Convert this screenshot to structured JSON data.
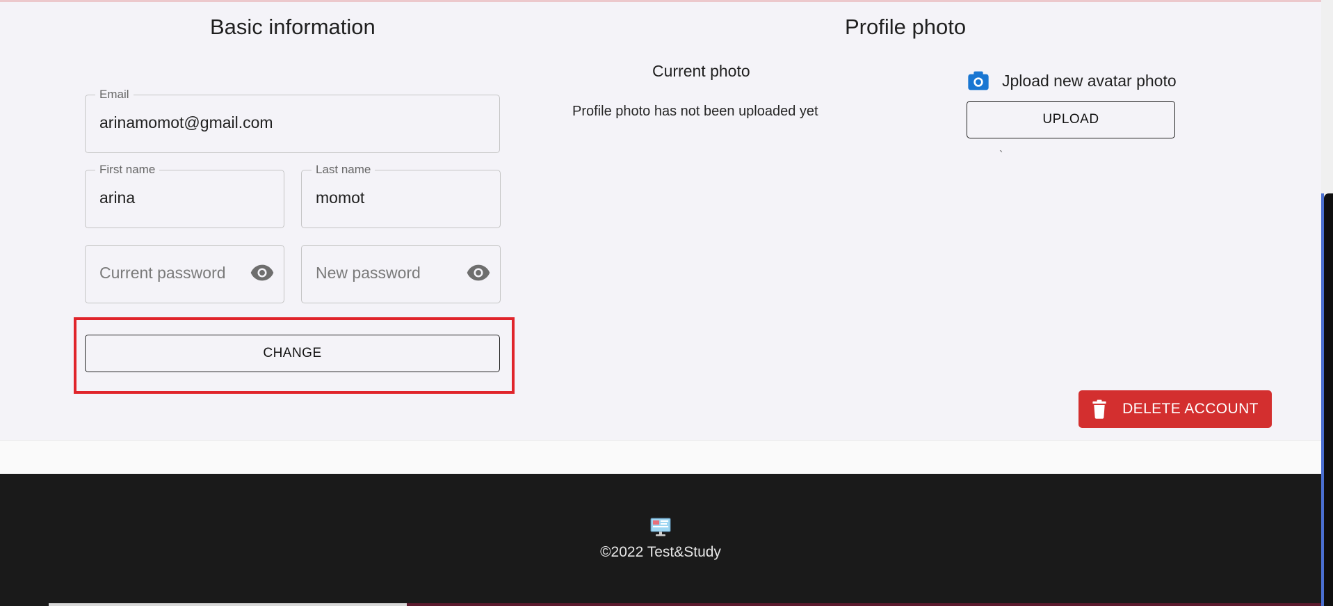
{
  "basic_info": {
    "title": "Basic information",
    "email": {
      "label": "Email",
      "value": "arinamomot@gmail.com"
    },
    "first_name": {
      "label": "First name",
      "value": "arina"
    },
    "last_name": {
      "label": "Last name",
      "value": "momot"
    },
    "current_password": {
      "placeholder": "Current password"
    },
    "new_password": {
      "placeholder": "New password"
    },
    "change_label": "CHANGE"
  },
  "profile_photo": {
    "title": "Profile photo",
    "current_title": "Current photo",
    "no_photo_text": "Profile photo has not been uploaded yet",
    "upload_label": "Jpload new avatar photo",
    "upload_button": "UPLOAD",
    "stray_mark": "`"
  },
  "delete_label": "DELETE ACCOUNT",
  "footer": {
    "copyright": "©2022 Test&Study"
  },
  "colors": {
    "accent_red": "#d32f2f",
    "highlight": "#e0242b",
    "camera_blue": "#1976d2",
    "footer_bg": "#1a1a1a"
  },
  "icons": {
    "eye": "visibility-icon",
    "camera": "camera-icon",
    "trash": "trash-icon",
    "logo": "monitor-logo-icon"
  }
}
